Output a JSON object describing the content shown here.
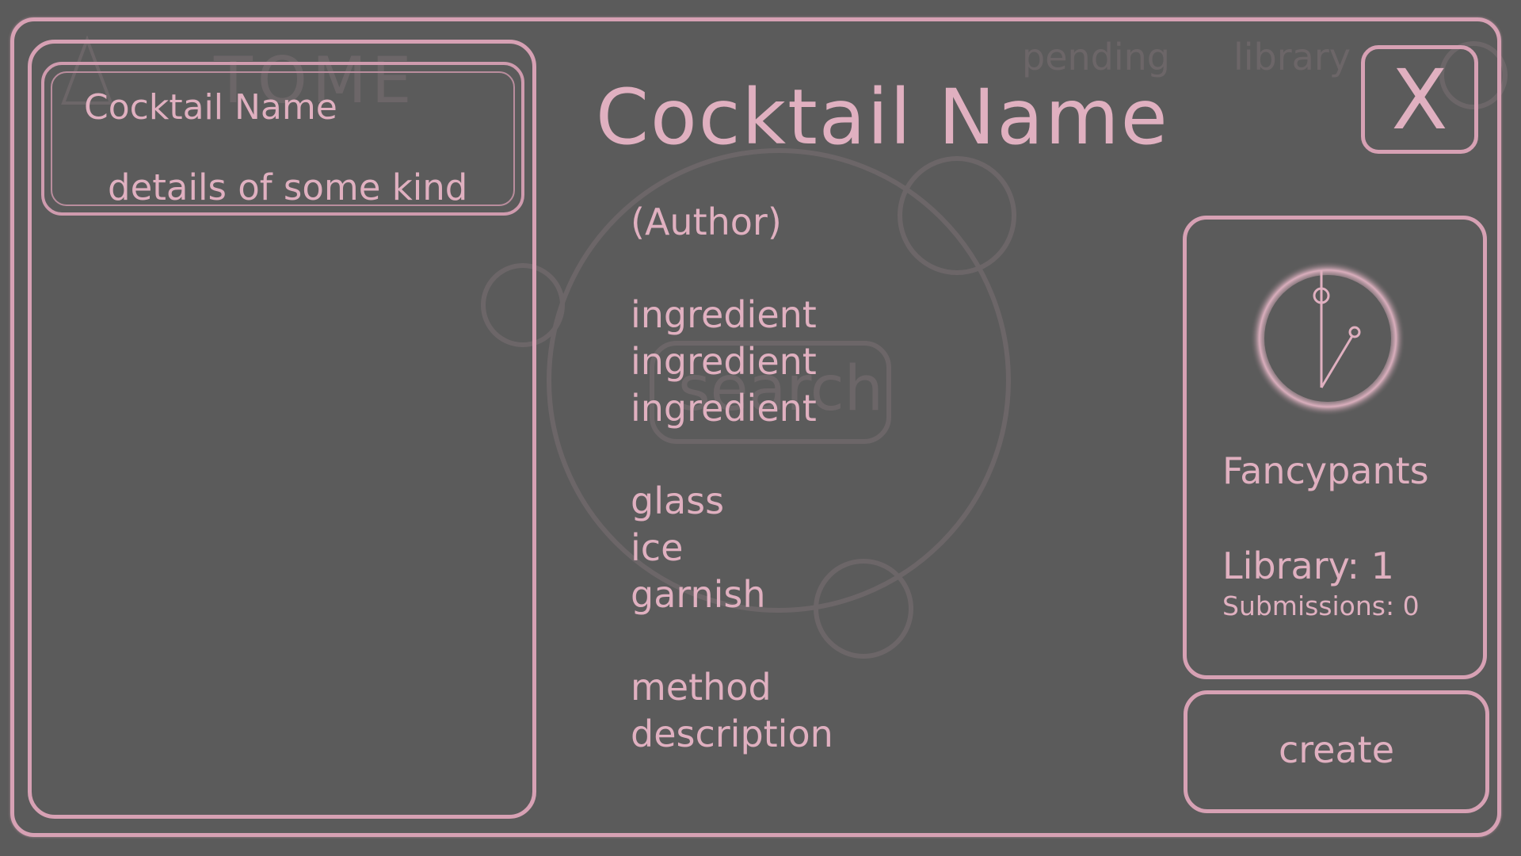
{
  "colors": {
    "accent": "#d7a1b4",
    "text": "#e0b0c0",
    "background": "#5b5b5b"
  },
  "background_layer": {
    "logo": "TOME",
    "nav_pending": "pending",
    "nav_library": "library",
    "search_label": "search"
  },
  "sidebar": {
    "items": [
      {
        "title": "Cocktail Name",
        "detail": "details of some kind"
      }
    ]
  },
  "detail": {
    "title": "Cocktail Name",
    "author": "(Author)",
    "ingredients": [
      "ingredient",
      "ingredient",
      "ingredient"
    ],
    "glass": "glass",
    "ice": "ice",
    "garnish": "garnish",
    "method": [
      "method",
      "description"
    ]
  },
  "close_label": "X",
  "profile": {
    "avatar_icon": "clock-icon",
    "name": "Fancypants",
    "library": "Library: 1",
    "submissions": "Submissions: 0"
  },
  "create_label": "create"
}
